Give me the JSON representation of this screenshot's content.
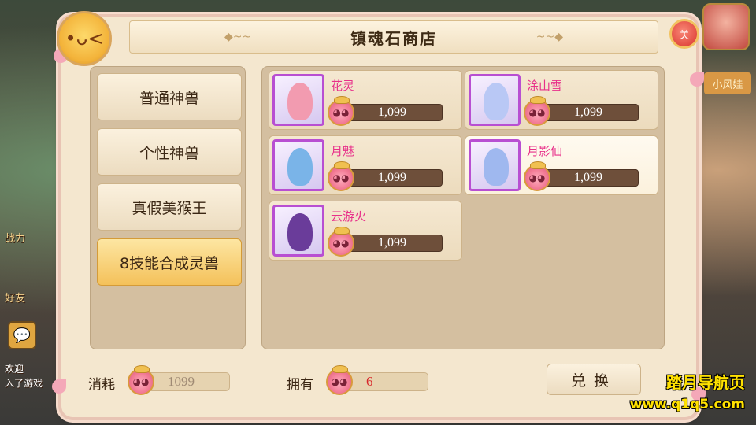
{
  "window": {
    "title": "镇魂石商店",
    "close_label": "关"
  },
  "categories": [
    {
      "label": "普通神兽",
      "active": false
    },
    {
      "label": "个性神兽",
      "active": false
    },
    {
      "label": "真假美猴王",
      "active": false
    },
    {
      "label": "8技能合成灵兽",
      "active": true
    }
  ],
  "items": [
    {
      "name": "花灵",
      "price": "1,099",
      "color": "#f29bb0"
    },
    {
      "name": "涂山雪",
      "price": "1,099",
      "color": "#b9c8f5"
    },
    {
      "name": "月魅",
      "price": "1,099",
      "color": "#7ab4e8"
    },
    {
      "name": "月影仙",
      "price": "1,099",
      "color": "#9fb8ef",
      "selected": true
    },
    {
      "name": "云游火",
      "price": "1,099",
      "color": "#6a3c9a"
    }
  ],
  "bottom": {
    "cost_label": "消耗",
    "cost_value": "1099",
    "own_label": "拥有",
    "own_value": "6",
    "exchange_label": "兑换"
  },
  "watermark": {
    "line1": "踏月导航页",
    "line2": "www.q1q5.com"
  },
  "background": {
    "text_1": "战力",
    "text_2": "好友",
    "text_3": "欢迎",
    "text_4": "入了游戏",
    "text_5": "小风娃"
  },
  "colors": {
    "accent_pink": "#e8308a",
    "panel": "#d4bfa0",
    "window": "#f4e7cf",
    "active_tab": "#f4c15a",
    "own_value": "#d8262a",
    "cost_value": "#9f8a74"
  },
  "icons": {
    "coin": "pig-coin-icon",
    "mascot": "mascot-icon",
    "chat": "chat-icon"
  }
}
